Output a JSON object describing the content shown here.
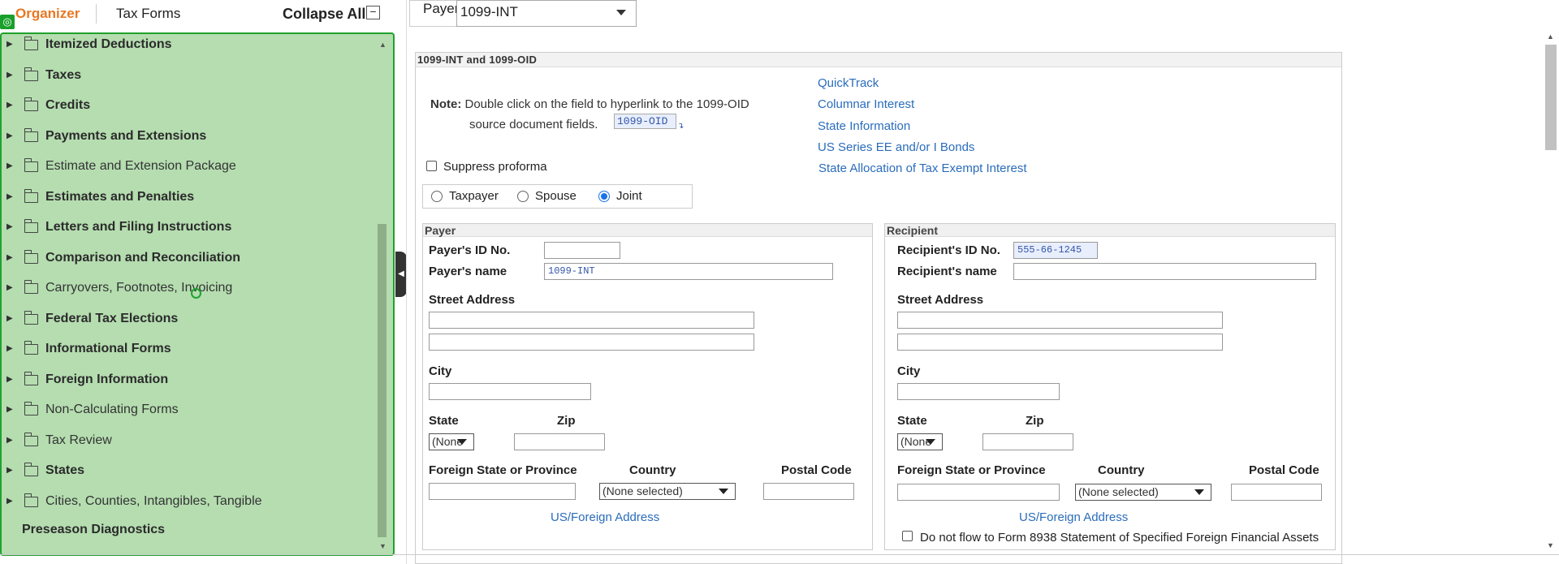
{
  "tabs": {
    "organizer": "Organizer",
    "tax_forms": "Tax Forms",
    "collapse_all": "Collapse All"
  },
  "tree": {
    "items": [
      {
        "label": "Itemized Deductions",
        "bold": true
      },
      {
        "label": "Taxes",
        "bold": true
      },
      {
        "label": "Credits",
        "bold": true
      },
      {
        "label": "Payments and Extensions",
        "bold": true
      },
      {
        "label": "Estimate and Extension Package",
        "bold": false
      },
      {
        "label": "Estimates and Penalties",
        "bold": true
      },
      {
        "label": "Letters and Filing Instructions",
        "bold": true
      },
      {
        "label": "Comparison and Reconciliation",
        "bold": true
      },
      {
        "label": "Carryovers, Footnotes, Invoicing",
        "bold": false
      },
      {
        "label": "Federal Tax Elections",
        "bold": true
      },
      {
        "label": "Informational Forms",
        "bold": true
      },
      {
        "label": "Foreign Information",
        "bold": true
      },
      {
        "label": "Non-Calculating Forms",
        "bold": false
      },
      {
        "label": "Tax Review",
        "bold": false
      },
      {
        "label": "States",
        "bold": true
      },
      {
        "label": "Cities, Counties, Intangibles, Tangible",
        "bold": false
      }
    ],
    "preseason": "Preseason Diagnostics"
  },
  "payer_selector": {
    "label": "Payer",
    "value": "1099-INT"
  },
  "form": {
    "title": "1099-INT and 1099-OID",
    "note_label": "Note:",
    "note_line1": "Double click on the field to hyperlink to the 1099-OID",
    "note_line2": "source document fields.",
    "oid_value": "1099-OID",
    "suppress_proforma": "Suppress proforma",
    "radios": {
      "taxpayer": "Taxpayer",
      "spouse": "Spouse",
      "joint": "Joint",
      "selected": "Joint"
    },
    "links": [
      "QuickTrack",
      "Columnar Interest",
      "State Information",
      "US Series EE and/or I Bonds",
      "State Allocation of Tax Exempt Interest"
    ],
    "payer": {
      "title": "Payer",
      "id_label": "Payer's ID No.",
      "id_value": "",
      "name_label": "Payer's name",
      "name_value": "1099-INT",
      "street_label": "Street Address",
      "city_label": "City",
      "state_label": "State",
      "state_value": "(None",
      "zip_label": "Zip",
      "foreign_label": "Foreign State or Province",
      "country_label": "Country",
      "country_value": "(None selected)",
      "postal_label": "Postal Code",
      "address_link": "US/Foreign Address"
    },
    "recipient": {
      "title": "Recipient",
      "id_label": "Recipient's ID No.",
      "id_value": "555-66-1245",
      "name_label": "Recipient's name",
      "name_value": "",
      "street_label": "Street Address",
      "city_label": "City",
      "state_label": "State",
      "state_value": "(None",
      "zip_label": "Zip",
      "foreign_label": "Foreign State or Province",
      "country_label": "Country",
      "country_value": "(None selected)",
      "postal_label": "Postal Code",
      "address_link": "US/Foreign Address",
      "no_flow": "Do not flow to Form 8938 Statement of Specified Foreign Financial Assets"
    }
  },
  "colors": {
    "accent_orange": "#e87722",
    "panel_green": "#b5ddb0",
    "panel_border": "#1fa22e",
    "link_blue": "#2a6cbb"
  }
}
